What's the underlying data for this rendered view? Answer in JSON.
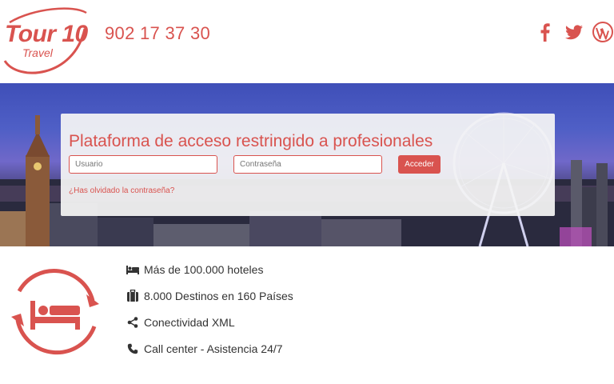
{
  "header": {
    "logo": {
      "brand": "Tour 10",
      "sub": "Travel"
    },
    "phone": "902 17 37 30",
    "social": [
      {
        "icon": "facebook-icon"
      },
      {
        "icon": "twitter-icon"
      },
      {
        "icon": "wordpress-icon"
      }
    ]
  },
  "login": {
    "title": "Plataforma de acceso restringido a profesionales",
    "user_placeholder": "Usuario",
    "pass_placeholder": "Contraseña",
    "submit_label": "Acceder",
    "forgot_link": "¿Has olvidado la contraseña?"
  },
  "features": [
    {
      "icon": "bed-icon",
      "label": "Más de 100.000 hoteles"
    },
    {
      "icon": "briefcase-icon",
      "label": "8.000 Destinos en 160 Países"
    },
    {
      "icon": "share-icon",
      "label": "Conectividad XML"
    },
    {
      "icon": "phone-icon",
      "label": "Call center - Asistencia 24/7"
    }
  ],
  "colors": {
    "accent": "#d9534f",
    "text": "#333333",
    "login_bg": "#f5f5f5"
  }
}
